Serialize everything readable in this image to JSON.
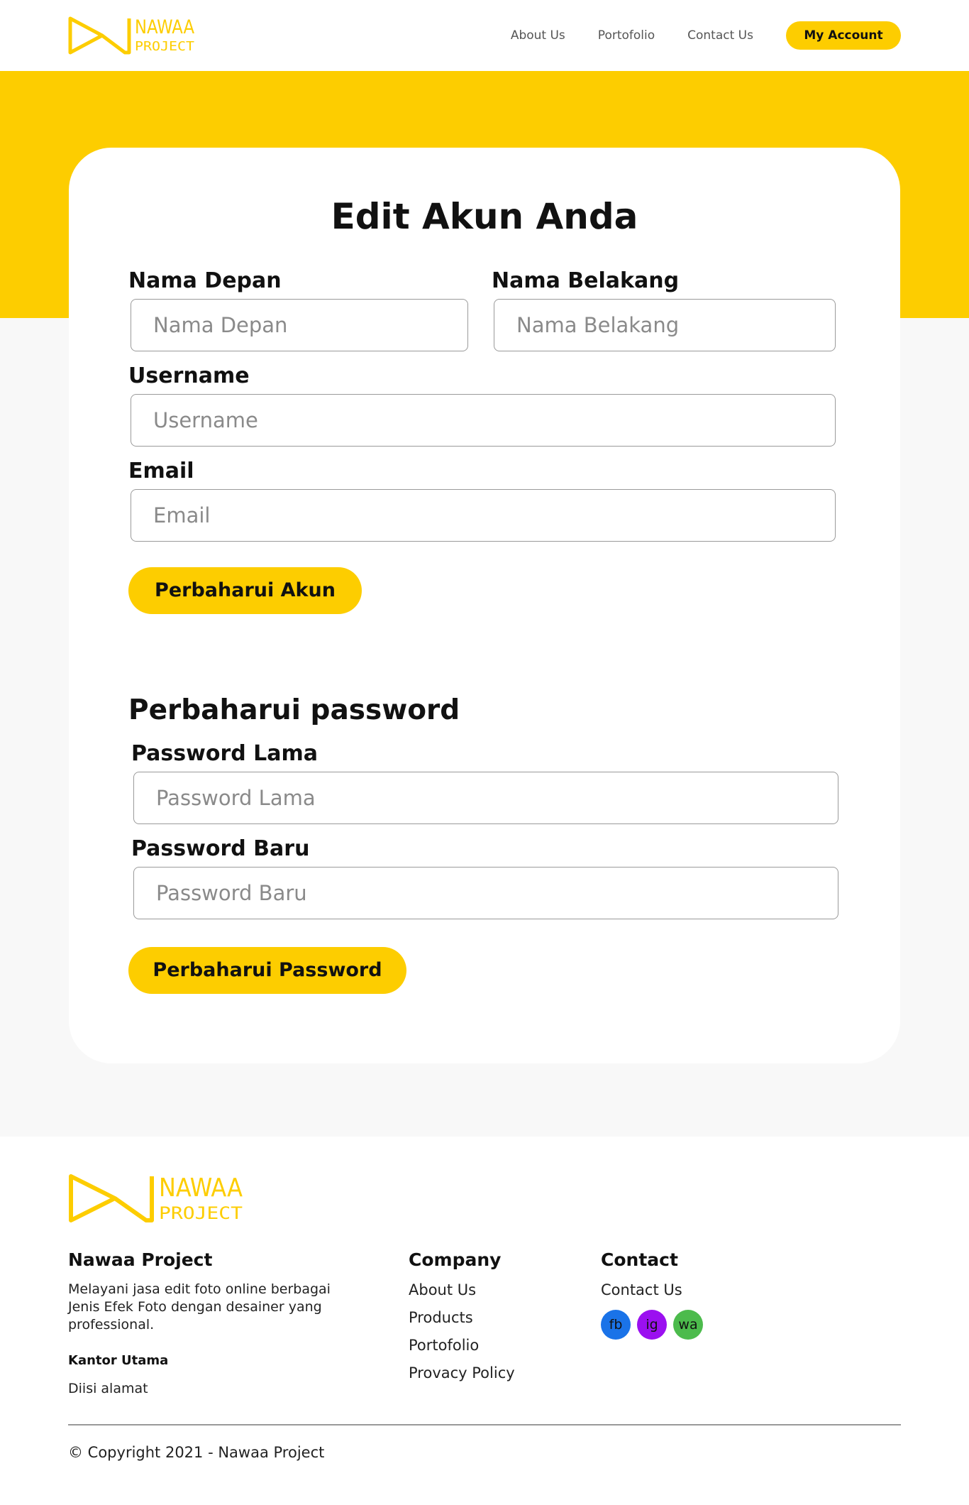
{
  "brand": {
    "logo_top": "NAWAA",
    "logo_bottom": "PROJECT",
    "accent_color": "#fdcd00"
  },
  "nav": {
    "items": [
      "About Us",
      "Portofolio",
      "Contact Us"
    ],
    "account_label": "My Account"
  },
  "form": {
    "title": "Edit Akun Anda",
    "first_name": {
      "label": "Nama Depan",
      "placeholder": "Nama Depan",
      "value": ""
    },
    "last_name": {
      "label": "Nama Belakang",
      "placeholder": "Nama Belakang",
      "value": ""
    },
    "username": {
      "label": "Username",
      "placeholder": "Username",
      "value": ""
    },
    "email": {
      "label": "Email",
      "placeholder": "Email",
      "value": ""
    },
    "submit_label": "Perbaharui Akun"
  },
  "password_form": {
    "title": "Perbaharui password",
    "old": {
      "label": "Password Lama",
      "placeholder": "Password Lama",
      "value": ""
    },
    "new": {
      "label": "Password Baru",
      "placeholder": "Password Baru",
      "value": ""
    },
    "submit_label": "Perbaharui Password"
  },
  "footer": {
    "about": {
      "title": "Nawaa Project",
      "description": "Melayani jasa edit foto online berbagai Jenis Efek Foto dengan desainer yang professional.",
      "office_label": "Kantor Utama",
      "address": "Diisi alamat"
    },
    "company": {
      "title": "Company",
      "links": [
        "About Us",
        "Products",
        "Portofolio",
        "Provacy Policy"
      ]
    },
    "contact": {
      "title": "Contact",
      "link": "Contact Us",
      "socials": [
        {
          "label": "fb",
          "icon": "facebook-icon",
          "color": "#1a73e8"
        },
        {
          "label": "ig",
          "icon": "instagram-icon",
          "color": "#9b10f0"
        },
        {
          "label": "wa",
          "icon": "whatsapp-icon",
          "color": "#4cbb4c"
        }
      ]
    },
    "copyright": "© Copyright 2021 - Nawaa Project"
  }
}
